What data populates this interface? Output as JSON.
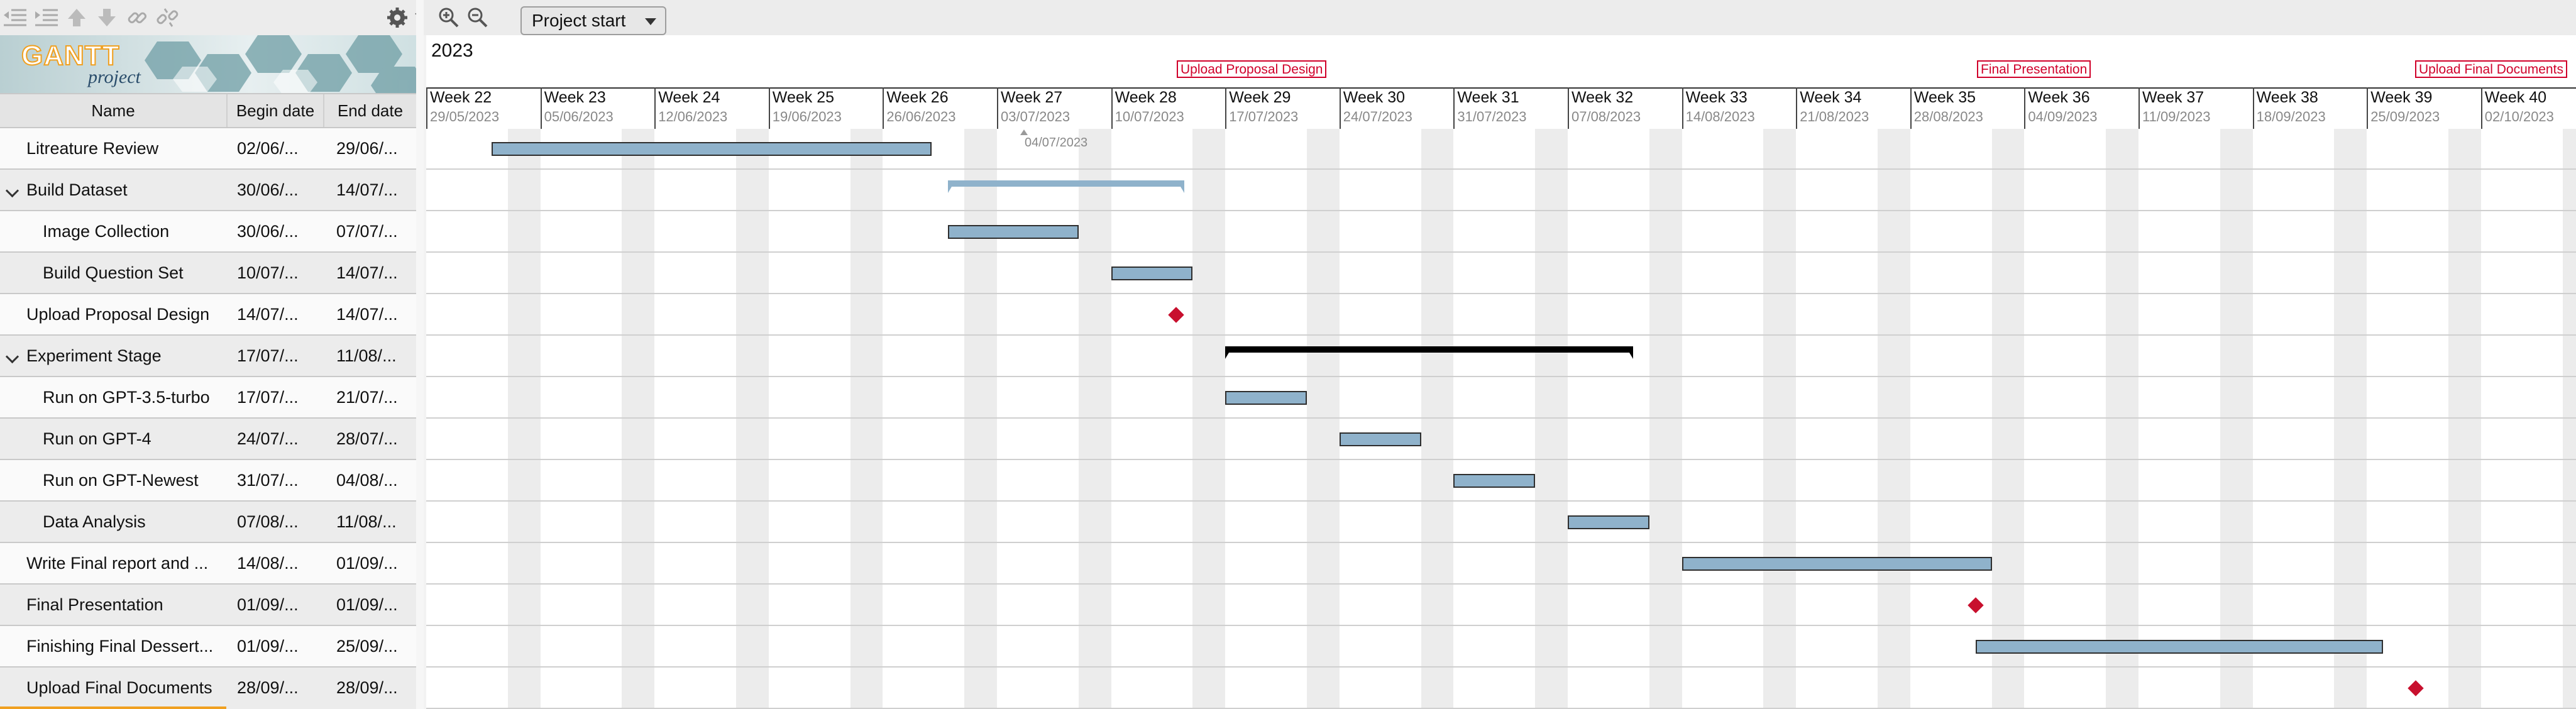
{
  "toolbar": {
    "icons": [
      "outdent-icon",
      "indent-icon",
      "move-up-icon",
      "move-down-icon",
      "link-icon",
      "unlink-icon",
      "settings-gear-icon",
      "collapse-panel-icon",
      "zoom-in-icon",
      "zoom-out-icon"
    ],
    "scope_select_value": "Project start"
  },
  "logo": {
    "main": "GANTT",
    "sub": "project"
  },
  "tree": {
    "columns": {
      "name": "Name",
      "begin": "Begin date",
      "end": "End date"
    },
    "rows": [
      {
        "name": "Litreature Review",
        "begin": "02/06/...",
        "end": "29/06/...",
        "level": 0,
        "group": false
      },
      {
        "name": "Build Dataset",
        "begin": "30/06/...",
        "end": "14/07/...",
        "level": 0,
        "group": true
      },
      {
        "name": "Image Collection",
        "begin": "30/06/...",
        "end": "07/07/...",
        "level": 1,
        "group": false
      },
      {
        "name": "Build Question Set",
        "begin": "10/07/...",
        "end": "14/07/...",
        "level": 1,
        "group": false
      },
      {
        "name": "Upload Proposal Design",
        "begin": "14/07/...",
        "end": "14/07/...",
        "level": 0,
        "group": false
      },
      {
        "name": "Experiment Stage",
        "begin": "17/07/...",
        "end": "11/08/...",
        "level": 0,
        "group": true
      },
      {
        "name": "Run on GPT-3.5-turbo",
        "begin": "17/07/...",
        "end": "21/07/...",
        "level": 1,
        "group": false
      },
      {
        "name": "Run on GPT-4",
        "begin": "24/07/...",
        "end": "28/07/...",
        "level": 1,
        "group": false
      },
      {
        "name": "Run on GPT-Newest",
        "begin": "31/07/...",
        "end": "04/08/...",
        "level": 1,
        "group": false
      },
      {
        "name": "Data Analysis",
        "begin": "07/08/...",
        "end": "11/08/...",
        "level": 1,
        "group": false
      },
      {
        "name": "Write Final report and ...",
        "begin": "14/08/...",
        "end": "01/09/...",
        "level": 0,
        "group": false
      },
      {
        "name": "Final Presentation",
        "begin": "01/09/...",
        "end": "01/09/...",
        "level": 0,
        "group": false
      },
      {
        "name": "Finishing Final Dessert...",
        "begin": "01/09/...",
        "end": "25/09/...",
        "level": 0,
        "group": false
      },
      {
        "name": "Upload Final Documents",
        "begin": "28/09/...",
        "end": "28/09/...",
        "level": 0,
        "group": false
      }
    ]
  },
  "timeline": {
    "year": "2023",
    "today_label": "04/07/2023",
    "weeks": [
      {
        "name": "Week 22",
        "date": "29/05/2023"
      },
      {
        "name": "Week 23",
        "date": "05/06/2023"
      },
      {
        "name": "Week 24",
        "date": "12/06/2023"
      },
      {
        "name": "Week 25",
        "date": "19/06/2023"
      },
      {
        "name": "Week 26",
        "date": "26/06/2023"
      },
      {
        "name": "Week 27",
        "date": "03/07/2023"
      },
      {
        "name": "Week 28",
        "date": "10/07/2023"
      },
      {
        "name": "Week 29",
        "date": "17/07/2023"
      },
      {
        "name": "Week 30",
        "date": "24/07/2023"
      },
      {
        "name": "Week 31",
        "date": "31/07/2023"
      },
      {
        "name": "Week 32",
        "date": "07/08/2023"
      },
      {
        "name": "Week 33",
        "date": "14/08/2023"
      },
      {
        "name": "Week 34",
        "date": "21/08/2023"
      },
      {
        "name": "Week 35",
        "date": "28/08/2023"
      },
      {
        "name": "Week 36",
        "date": "04/09/2023"
      },
      {
        "name": "Week 37",
        "date": "11/09/2023"
      },
      {
        "name": "Week 38",
        "date": "18/09/2023"
      },
      {
        "name": "Week 39",
        "date": "25/09/2023"
      },
      {
        "name": "Week 40",
        "date": "02/10/2023"
      }
    ],
    "milestone_flags": [
      {
        "label": "Upload Proposal Design"
      },
      {
        "label": "Final Presentation"
      },
      {
        "label": "Upload Final Documents"
      }
    ],
    "colors": {
      "task_bar": "#8fb2cb",
      "summary_dataset": "#8fb2cb",
      "summary_experiment": "#000000",
      "milestone": "#c8102e",
      "flag": "#d0002a"
    }
  }
}
